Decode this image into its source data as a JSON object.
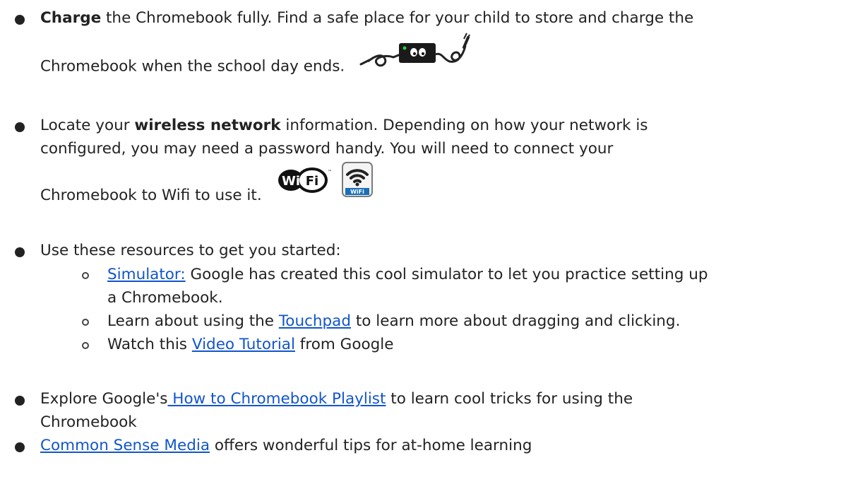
{
  "items": [
    {
      "lines": [
        {
          "bold": "Charge",
          "text": " the Chromebook fully.  Find a safe place for your child to store and charge the"
        },
        {
          "text": "Chromebook when the school day ends."
        }
      ]
    },
    {
      "lines": [
        {
          "pre": "Locate your ",
          "bold": "wireless network",
          "post": " information. Depending on how your network is"
        },
        {
          "text": "configured, you may need a password handy.  You will need to connect your"
        },
        {
          "text": "Chromebook to Wifi to use it."
        }
      ]
    },
    {
      "text": "Use these resources to get you started:",
      "subitems": [
        {
          "link": "Simulator:",
          "post": " Google has created this cool simulator to let you practice setting up",
          "line2": "a Chromebook."
        },
        {
          "pre": "Learn about using the ",
          "link": "Touchpad",
          "post": " to learn more about dragging and clicking."
        },
        {
          "pre": "Watch this ",
          "link": "Video Tutorial",
          "post": " from Google"
        }
      ]
    },
    {
      "pre": "Explore Google's",
      "link": " How to Chromebook Playlist",
      "post": " to learn cool tricks for using the",
      "line2": "Chromebook"
    },
    {
      "link": "Common Sense Media",
      "post": " offers wonderful tips for at-home learning"
    }
  ],
  "icons": {
    "charger": "charger-cable-icon",
    "wifi_logo": "wifi-logo-icon",
    "wifi_sign": "wifi-sign-icon",
    "wifi_logo_text_left": "Wi",
    "wifi_logo_text_right": "Fi",
    "wifi_sign_text": "WiFi"
  },
  "colors": {
    "text": "#222222",
    "link": "#1155cc",
    "wifi_blue": "#1a6fb8"
  }
}
